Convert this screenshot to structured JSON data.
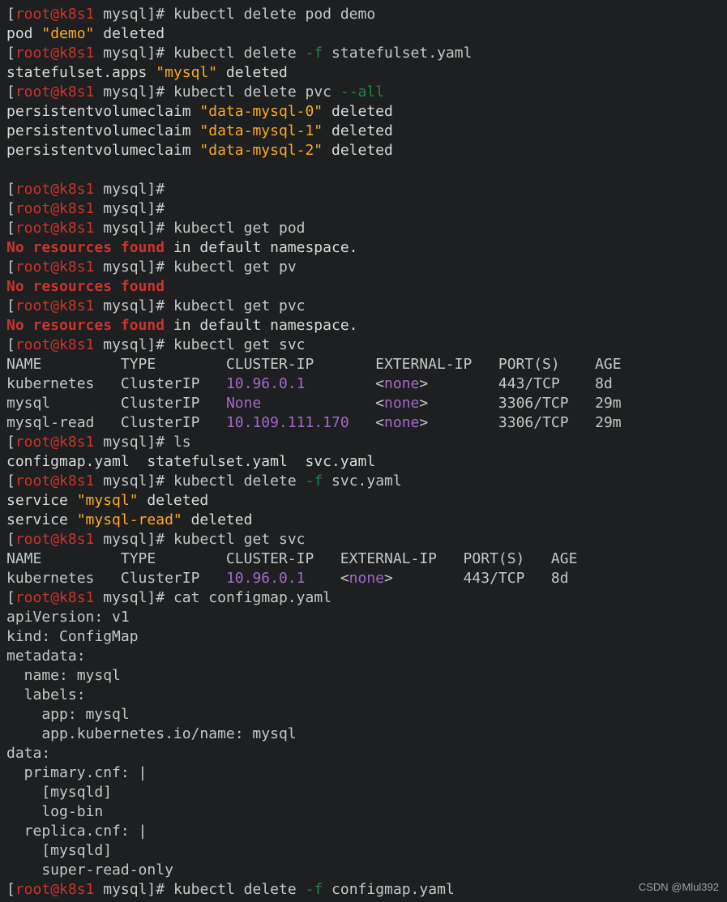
{
  "prompt": {
    "lbracket": "[",
    "rbracket": "]",
    "userhost": "root@k8s1",
    "path": " mysql",
    "end": "#"
  },
  "cmds": {
    "c1": " kubectl delete pod demo",
    "c2": " kubectl delete ",
    "c2flag": "-f",
    "c2rest": " statefulset.yaml",
    "c3a": " kubectl delete pvc ",
    "c3flag": "--all",
    "blank1": "",
    "blank2": "",
    "c4": " kubectl get pod",
    "c5": " kubectl get pv",
    "c6": " kubectl get pvc",
    "c7": " kubectl get svc",
    "c8": " ls",
    "c9a": " kubectl delete ",
    "c9flag": "-f",
    "c9rest": " svc.yaml",
    "c10": " kubectl get svc",
    "c11": " cat configmap.yaml",
    "c12a": " kubectl delete ",
    "c12flag": "-f",
    "c12rest": " configmap.yaml"
  },
  "out": {
    "podDeletedPre": "pod ",
    "podDeletedQ": "\"demo\"",
    "podDeletedPost": " deleted",
    "ssDeletedPre": "statefulset.apps ",
    "ssDeletedQ": "\"mysql\"",
    "ssDeletedPost": " deleted",
    "pvc0pre": "persistentvolumeclaim ",
    "pvc0q": "\"data-mysql-0\"",
    "pvc0post": " deleted",
    "pvc1pre": "persistentvolumeclaim ",
    "pvc1q": "\"data-mysql-1\"",
    "pvc1post": " deleted",
    "pvc2pre": "persistentvolumeclaim ",
    "pvc2q": "\"data-mysql-2\"",
    "pvc2post": " deleted",
    "noResRed": "No resources found",
    "noResRest": " in default namespace.",
    "lsOut": "configmap.yaml  statefulset.yaml  svc.yaml",
    "svcDel1Pre": "service ",
    "svcDel1Q": "\"mysql\"",
    "svcDel1Post": " deleted",
    "svcDel2Pre": "service ",
    "svcDel2Q": "\"mysql-read\"",
    "svcDel2Post": " deleted"
  },
  "svcTable1": {
    "header": "NAME         TYPE        CLUSTER-IP       EXTERNAL-IP   PORT(S)    AGE",
    "rows": [
      {
        "lead": "kubernetes   ClusterIP   ",
        "clusterip": "10.96.0.1     ",
        "gap": "   <",
        "none": "none",
        "tail": ">        443/TCP    8d"
      },
      {
        "lead": "mysql        ClusterIP   ",
        "clusterip": "None          ",
        "gap": "   <",
        "none": "none",
        "tail": ">        3306/TCP   29m"
      },
      {
        "lead": "mysql-read   ClusterIP   ",
        "clusterip": "10.109.111.170",
        "gap": "   <",
        "none": "none",
        "tail": ">        3306/TCP   29m"
      }
    ]
  },
  "svcTable2": {
    "header": "NAME         TYPE        CLUSTER-IP   EXTERNAL-IP   PORT(S)   AGE",
    "rows": [
      {
        "lead": "kubernetes   ClusterIP   ",
        "clusterip": "10.96.0.1 ",
        "gap": "   <",
        "none": "none",
        "tail": ">        443/TCP   8d"
      }
    ]
  },
  "configmap": {
    "l1": "apiVersion: v1",
    "l2": "kind: ConfigMap",
    "l3": "metadata:",
    "l4": "  name: mysql",
    "l5": "  labels:",
    "l6": "    app: mysql",
    "l7": "    app.kubernetes.io/name: mysql",
    "l8": "data:",
    "l9": "  primary.cnf: |",
    "l10": "    [mysqld]",
    "l11": "    log-bin",
    "l12": "  replica.cnf: |",
    "l13": "    [mysqld]",
    "l14": "    super-read-only"
  },
  "watermark": "CSDN @Mlul392"
}
